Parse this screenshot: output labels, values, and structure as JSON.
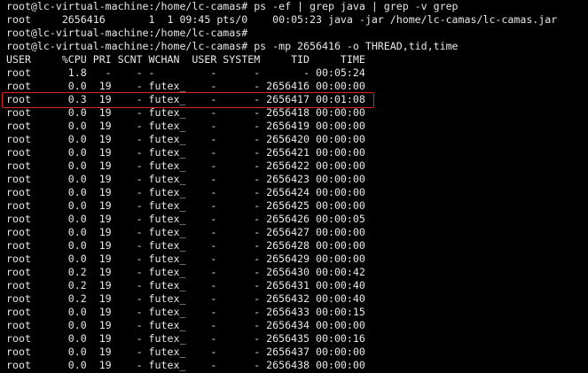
{
  "terminal": {
    "colors": {
      "background": "#000000",
      "text": "#e8e8e8",
      "highlight": "#e0241e"
    },
    "lines": [
      "root@lc-virtual-machine:/home/lc-camas# ps -ef | grep java | grep -v grep",
      "root     2656416       1  1 09:45 pts/0    00:05:23 java -jar /home/lc-camas/lc-camas.jar",
      "root@lc-virtual-machine:/home/lc-camas#",
      "root@lc-virtual-machine:/home/lc-camas# ps -mp 2656416 -o THREAD,tid,time",
      "USER     %CPU PRI SCNT WCHAN  USER SYSTEM     TID     TIME",
      "root      1.8   -    - -         -      -       - 00:05:24",
      "root      0.0  19    - futex_    -      - 2656416 00:00:00",
      "root      0.3  19    - futex_    -      - 2656417 00:01:08",
      "root      0.0  19    - futex_    -      - 2656418 00:00:00",
      "root      0.0  19    - futex_    -      - 2656419 00:00:00",
      "root      0.0  19    - futex_    -      - 2656420 00:00:00",
      "root      0.0  19    - futex_    -      - 2656421 00:00:00",
      "root      0.0  19    - futex_    -      - 2656422 00:00:00",
      "root      0.0  19    - futex_    -      - 2656423 00:00:00",
      "root      0.0  19    - futex_    -      - 2656424 00:00:00",
      "root      0.0  19    - futex_    -      - 2656425 00:00:00",
      "root      0.0  19    - futex_    -      - 2656426 00:00:05",
      "root      0.0  19    - futex_    -      - 2656427 00:00:00",
      "root      0.0  19    - futex_    -      - 2656428 00:00:00",
      "root      0.0  19    - futex_    -      - 2656429 00:00:00",
      "root      0.2  19    - futex_    -      - 2656430 00:00:42",
      "root      0.2  19    - futex_    -      - 2656431 00:00:40",
      "root      0.2  19    - futex_    -      - 2656432 00:00:40",
      "root      0.0  19    - futex_    -      - 2656433 00:00:15",
      "root      0.0  19    - futex_    -      - 2656434 00:00:00",
      "root      0.0  19    - futex_    -      - 2656435 00:00:16",
      "root      0.0  19    - futex_    -      - 2656437 00:00:00",
      "root      0.0  19    - futex_    -      - 2656438 00:00:00"
    ]
  }
}
